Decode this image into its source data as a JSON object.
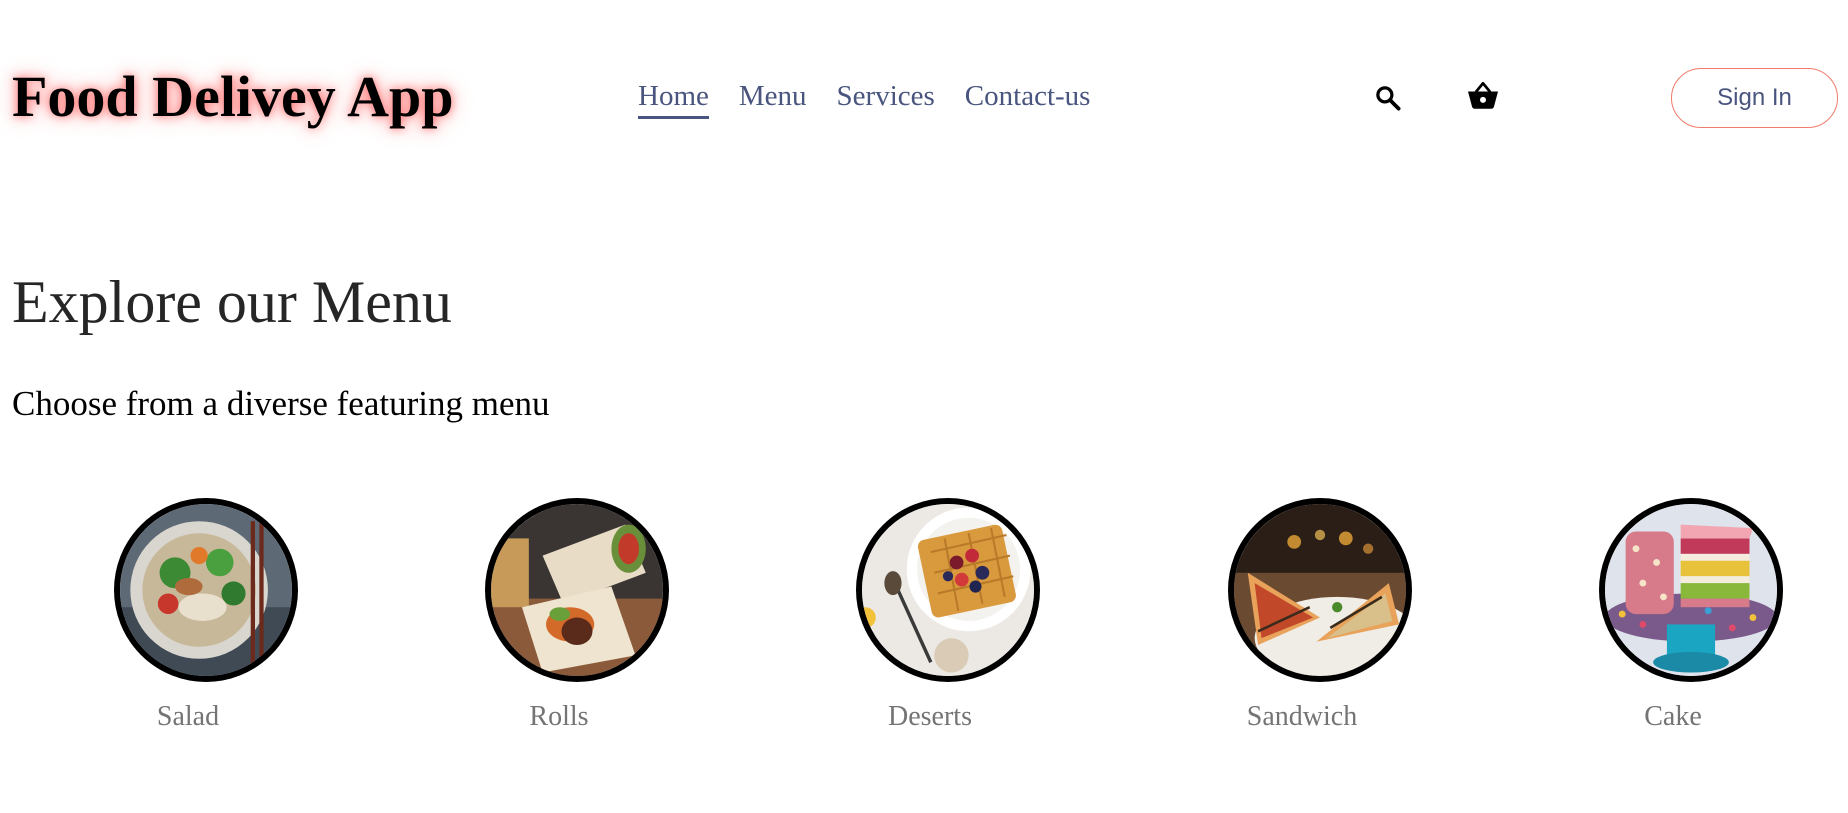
{
  "header": {
    "logo": "Food Delivey App",
    "nav": [
      {
        "label": "Home",
        "active": true
      },
      {
        "label": "Menu",
        "active": false
      },
      {
        "label": "Services",
        "active": false
      },
      {
        "label": "Contact-us",
        "active": false
      }
    ],
    "icons": {
      "search": "search-icon",
      "basket": "basket-icon"
    },
    "sign_in_label": "Sign In"
  },
  "explore": {
    "title": "Explore our Menu",
    "subtitle": "Choose from a diverse featuring menu",
    "items": [
      {
        "label": "Salad",
        "image": "salad-bowl-photo"
      },
      {
        "label": "Rolls",
        "image": "wrap-rolls-photo"
      },
      {
        "label": "Deserts",
        "image": "waffle-berries-photo"
      },
      {
        "label": "Sandwich",
        "image": "toasted-sandwich-photo"
      },
      {
        "label": "Cake",
        "image": "layered-cake-photo"
      }
    ]
  },
  "colors": {
    "nav_text": "#49557e",
    "logo_glow": "#ff0000",
    "signin_border": "#f07b6c",
    "item_label": "#747474",
    "circle_border": "#000000"
  }
}
